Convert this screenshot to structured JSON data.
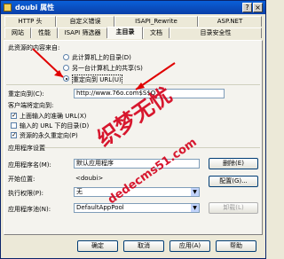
{
  "window": {
    "title": "doubi 属性",
    "min": "_",
    "close": "×"
  },
  "tabs_row1": [
    "HTTP 头",
    "自定义错误",
    "ISAPI_Rewrite",
    "ASP.NET"
  ],
  "tabs_row2": [
    "网站",
    "性能",
    "ISAPI 筛选器",
    "主目录",
    "文档",
    "目录安全性"
  ],
  "content": {
    "source_label": "此资源的内容来自:",
    "opt1": "此计算机上的目录(D)",
    "opt2": "另一台计算机上的共享(S)",
    "opt3": "重定向到 URL(U)",
    "redirect_label": "重定向到(C):",
    "redirect_value": "http://www.76o.com$S$Q",
    "client_label": "客户端将定向到:",
    "chk1": "上面输入的准确 URL(X)",
    "chk2": "输入的 URL 下的目录(D)",
    "chk3": "资源的永久重定向(P)",
    "app_section": "应用程序设置",
    "app_name_label": "应用程序名(M):",
    "app_name_value": "默认应用程序",
    "delete_btn": "删除(E)",
    "start_label": "开始位置:",
    "start_value": "<doubi>",
    "config_btn": "配置(G)...",
    "exec_label": "执行权限(P):",
    "exec_value": "无",
    "pool_label": "应用程序池(N):",
    "pool_value": "DefaultAppPool",
    "unload_btn": "卸载(L)"
  },
  "footer": {
    "ok": "确定",
    "cancel": "取消",
    "apply": "应用(A)",
    "help": "帮助"
  },
  "watermark": {
    "text1": "织梦无忧",
    "text2": "dedecms51.com"
  }
}
